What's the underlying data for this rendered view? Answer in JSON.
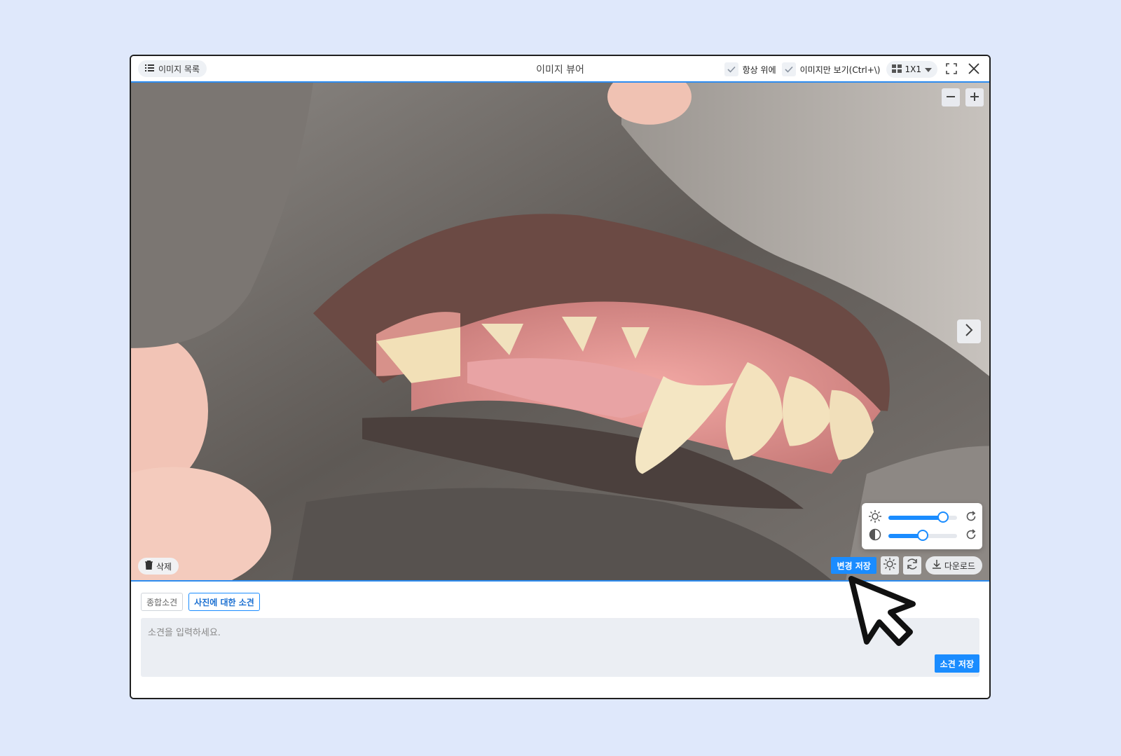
{
  "window": {
    "title": "이미지 뷰어",
    "list_button_label": "이미지 목록",
    "always_on_top_label": "항상 위에",
    "image_only_label": "이미지만 보기(Ctrl+\\)",
    "layout_selector_value": "1X1",
    "always_on_top_checked": true,
    "image_only_checked": true
  },
  "viewer": {
    "image_description": "close-up photo of a dog's mouth showing teeth and gums",
    "delete_label": "삭제",
    "save_changes_label": "변경 저장",
    "download_label": "다운로드",
    "brightness_level": 0.8,
    "contrast_level": 0.5
  },
  "opinion": {
    "tabs": [
      {
        "label": "종합소견",
        "active": false
      },
      {
        "label": "사진에 대한 소견",
        "active": true
      }
    ],
    "placeholder": "소견을 입력하세요.",
    "save_label": "소견 저장"
  },
  "colors": {
    "accent": "#1a8cff",
    "background": "#dfe8fb"
  }
}
